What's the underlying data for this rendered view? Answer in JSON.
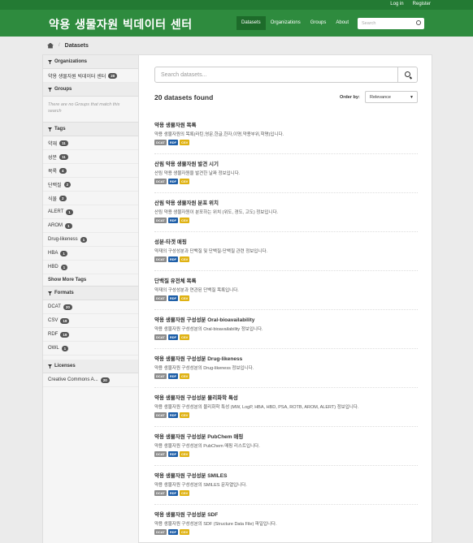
{
  "account": {
    "login": "Log in",
    "register": "Register"
  },
  "site_title": "약용 생물자원 빅데이터 센터",
  "nav": [
    {
      "label": "Datasets",
      "active": true
    },
    {
      "label": "Organizations",
      "active": false
    },
    {
      "label": "Groups",
      "active": false
    },
    {
      "label": "About",
      "active": false
    }
  ],
  "header_search": {
    "placeholder": "Search"
  },
  "breadcrumb": {
    "current": "Datasets"
  },
  "sidebar": {
    "organizations": {
      "title": "Organizations",
      "items": [
        {
          "label": "약용 생물자원 빅데이터 센터",
          "count": "20"
        }
      ]
    },
    "groups": {
      "title": "Groups",
      "empty": "There are no Groups that match this search"
    },
    "tags": {
      "title": "Tags",
      "items": [
        {
          "label": "약재",
          "count": "11"
        },
        {
          "label": "성분",
          "count": "11"
        },
        {
          "label": "목록",
          "count": "4"
        },
        {
          "label": "단백질",
          "count": "2"
        },
        {
          "label": "식물",
          "count": "2"
        },
        {
          "label": "ALERT",
          "count": "1"
        },
        {
          "label": "AROM",
          "count": "1"
        },
        {
          "label": "Drug-likeness",
          "count": "1"
        },
        {
          "label": "HBA",
          "count": "1"
        },
        {
          "label": "HBD",
          "count": "1"
        }
      ],
      "show_more": "Show More Tags"
    },
    "formats": {
      "title": "Formats",
      "items": [
        {
          "label": "DCAT",
          "count": "20"
        },
        {
          "label": "CSV",
          "count": "19"
        },
        {
          "label": "RDF",
          "count": "19"
        },
        {
          "label": "OWL",
          "count": "1"
        }
      ]
    },
    "licenses": {
      "title": "Licenses",
      "items": [
        {
          "label": "Creative Commons A...",
          "count": "20"
        }
      ]
    }
  },
  "search": {
    "placeholder": "Search datasets..."
  },
  "results_count": "20 datasets found",
  "order": {
    "label": "Order by:",
    "selected": "Relevance"
  },
  "format_colors": {
    "DCAT": "#8c8c8c",
    "RDF": "#1f5fa8",
    "CSV": "#dfb213"
  },
  "datasets": [
    {
      "title": "약용 생물자원 목록",
      "notes": "약용 생물자원의 목록(라틴,영문,한글,한자,이명,약용부위,학명)입니다.",
      "formats": [
        "DCAT",
        "RDF",
        "CSV"
      ]
    },
    {
      "title": "산림 약용 생물자원 발견 시기",
      "notes": "산림 약용 생물자원을 발견한 날짜 정보입니다.",
      "formats": [
        "DCAT",
        "RDF",
        "CSV"
      ]
    },
    {
      "title": "산림 약용 생물자원 분포 위치",
      "notes": "산림 약용 생물자원이 분포하는 위치 (위도, 경도, 고도) 정보입니다.",
      "formats": [
        "DCAT",
        "RDF",
        "CSV"
      ]
    },
    {
      "title": "성분-타겟 매핑",
      "notes": "약재의 구성성분과 단백질 및 단백질-단백질 관련 정보입니다.",
      "formats": [
        "DCAT",
        "RDF",
        "CSV"
      ]
    },
    {
      "title": "단백질 유전체 목록",
      "notes": "약재의 구성성분과 연관된 단백질 목록입니다.",
      "formats": [
        "DCAT",
        "RDF",
        "CSV"
      ]
    },
    {
      "title": "약용 생물자원 구성성분 Oral-bioavailability",
      "notes": "약용 생물자원 구성성분의 Oral-bioavailability 정보입니다.",
      "formats": [
        "DCAT",
        "RDF",
        "CSV"
      ]
    },
    {
      "title": "약용 생물자원 구성성분 Drug-likeness",
      "notes": "약용 생물자원 구성성분의 Drug-likeness 정보입니다.",
      "formats": [
        "DCAT",
        "RDF",
        "CSV"
      ]
    },
    {
      "title": "약용 생물자원 구성성분 물리화학 특성",
      "notes": "약용 생물자원 구성성분의 물리화학 특성 (MW, LogP, HBA, HBD, PSA, ROTB, AROM, ALERT) 정보입니다.",
      "formats": [
        "DCAT",
        "RDF",
        "CSV"
      ]
    },
    {
      "title": "약용 생물자원 구성성분 PubChem 매핑",
      "notes": "약용 생물자원 구성성분의 PubChem 매핑 리스트입니다.",
      "formats": [
        "DCAT",
        "RDF",
        "CSV"
      ]
    },
    {
      "title": "약용 생물자원 구성성분 SMILES",
      "notes": "약용 생물자원 구성성분의 SMILES 문자열입니다.",
      "formats": [
        "DCAT",
        "RDF",
        "CSV"
      ]
    },
    {
      "title": "약용 생물자원 구성성분 SDF",
      "notes": "약용 생물자원 구성성분의 SDF (Structure Data File) 파일입니다.",
      "formats": [
        "DCAT",
        "RDF",
        "CSV"
      ]
    }
  ]
}
